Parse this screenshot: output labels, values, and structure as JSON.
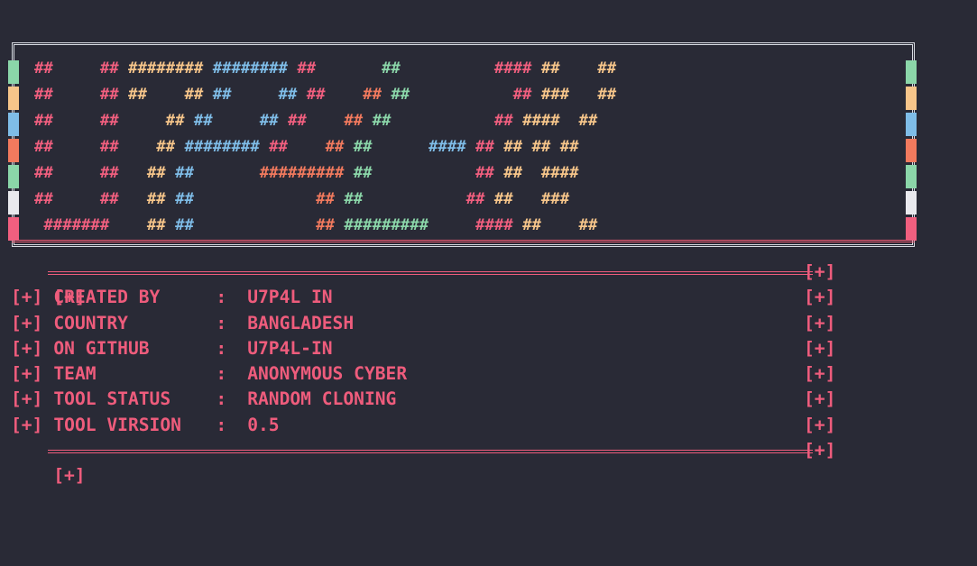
{
  "banner": {
    "rows": [
      [
        [
          "c1",
          "##     ## "
        ],
        [
          "c2",
          "######## "
        ],
        [
          "c3",
          "######## "
        ],
        [
          "c1",
          "##       "
        ],
        [
          "c5",
          "##          "
        ],
        [
          "c1",
          "#### "
        ],
        [
          "c2",
          "##    "
        ],
        [
          "c2",
          "##"
        ]
      ],
      [
        [
          "c1",
          "##     ## "
        ],
        [
          "c2",
          "##    ## "
        ],
        [
          "c3",
          "##     ## "
        ],
        [
          "c1",
          "##    "
        ],
        [
          "c4",
          "## "
        ],
        [
          "c5",
          "##           "
        ],
        [
          "c1",
          "## "
        ],
        [
          "c2",
          "###   "
        ],
        [
          "c2",
          "##"
        ]
      ],
      [
        [
          "c1",
          "##     ##     "
        ],
        [
          "c2",
          "## "
        ],
        [
          "c3",
          "##     ## "
        ],
        [
          "c1",
          "##    "
        ],
        [
          "c4",
          "## "
        ],
        [
          "c5",
          "##           "
        ],
        [
          "c1",
          "## "
        ],
        [
          "c2",
          "####  "
        ],
        [
          "c2",
          "##"
        ]
      ],
      [
        [
          "c1",
          "##     ##    "
        ],
        [
          "c2",
          "## "
        ],
        [
          "c3",
          "######## "
        ],
        [
          "c1",
          "##    "
        ],
        [
          "c4",
          "## "
        ],
        [
          "c5",
          "##      "
        ],
        [
          "c3",
          "#### "
        ],
        [
          "c1",
          "## "
        ],
        [
          "c2",
          "## ## "
        ],
        [
          "c2",
          "##"
        ]
      ],
      [
        [
          "c1",
          "##     ##   "
        ],
        [
          "c2",
          "## "
        ],
        [
          "c3",
          "##       "
        ],
        [
          "c4",
          "######### "
        ],
        [
          "c5",
          "##           "
        ],
        [
          "c1",
          "## "
        ],
        [
          "c2",
          "##  ####"
        ]
      ],
      [
        [
          "c1",
          "##     ##   "
        ],
        [
          "c2",
          "## "
        ],
        [
          "c3",
          "##             "
        ],
        [
          "c4",
          "## "
        ],
        [
          "c5",
          "##           "
        ],
        [
          "c1",
          "## "
        ],
        [
          "c2",
          "##   ###"
        ]
      ],
      [
        [
          "c1",
          " #######    "
        ],
        [
          "c2",
          "## "
        ],
        [
          "c3",
          "##             "
        ],
        [
          "c4",
          "## "
        ],
        [
          "c5",
          "#########     "
        ],
        [
          "c1",
          "#### "
        ],
        [
          "c2",
          "##    ##"
        ]
      ]
    ],
    "stripe_colors": [
      "#8bd6a9",
      "#f6c58a",
      "#7fbde8",
      "#f27a5e",
      "#8bd6a9",
      "#e9e9ee",
      "#f15f7f"
    ]
  },
  "info": {
    "prefix": "[+]",
    "rows": [
      {
        "key": "CREATED BY",
        "sep": ":",
        "value": "U7P4L IN"
      },
      {
        "key": "COUNTRY",
        "sep": ":",
        "value": "BANGLADESH"
      },
      {
        "key": "ON GITHUB",
        "sep": ":",
        "value": "U7P4L-IN"
      },
      {
        "key": "TEAM",
        "sep": ":",
        "value": "ANONYMOUS CYBER"
      },
      {
        "key": "TOOL STATUS",
        "sep": ":",
        "value": "RANDOM CLONING"
      },
      {
        "key": "TOOL VIRSION",
        "sep": ":",
        "value": "0.5"
      }
    ]
  },
  "colors": {
    "background": "#292a36",
    "accent": "#ee5c7c"
  }
}
